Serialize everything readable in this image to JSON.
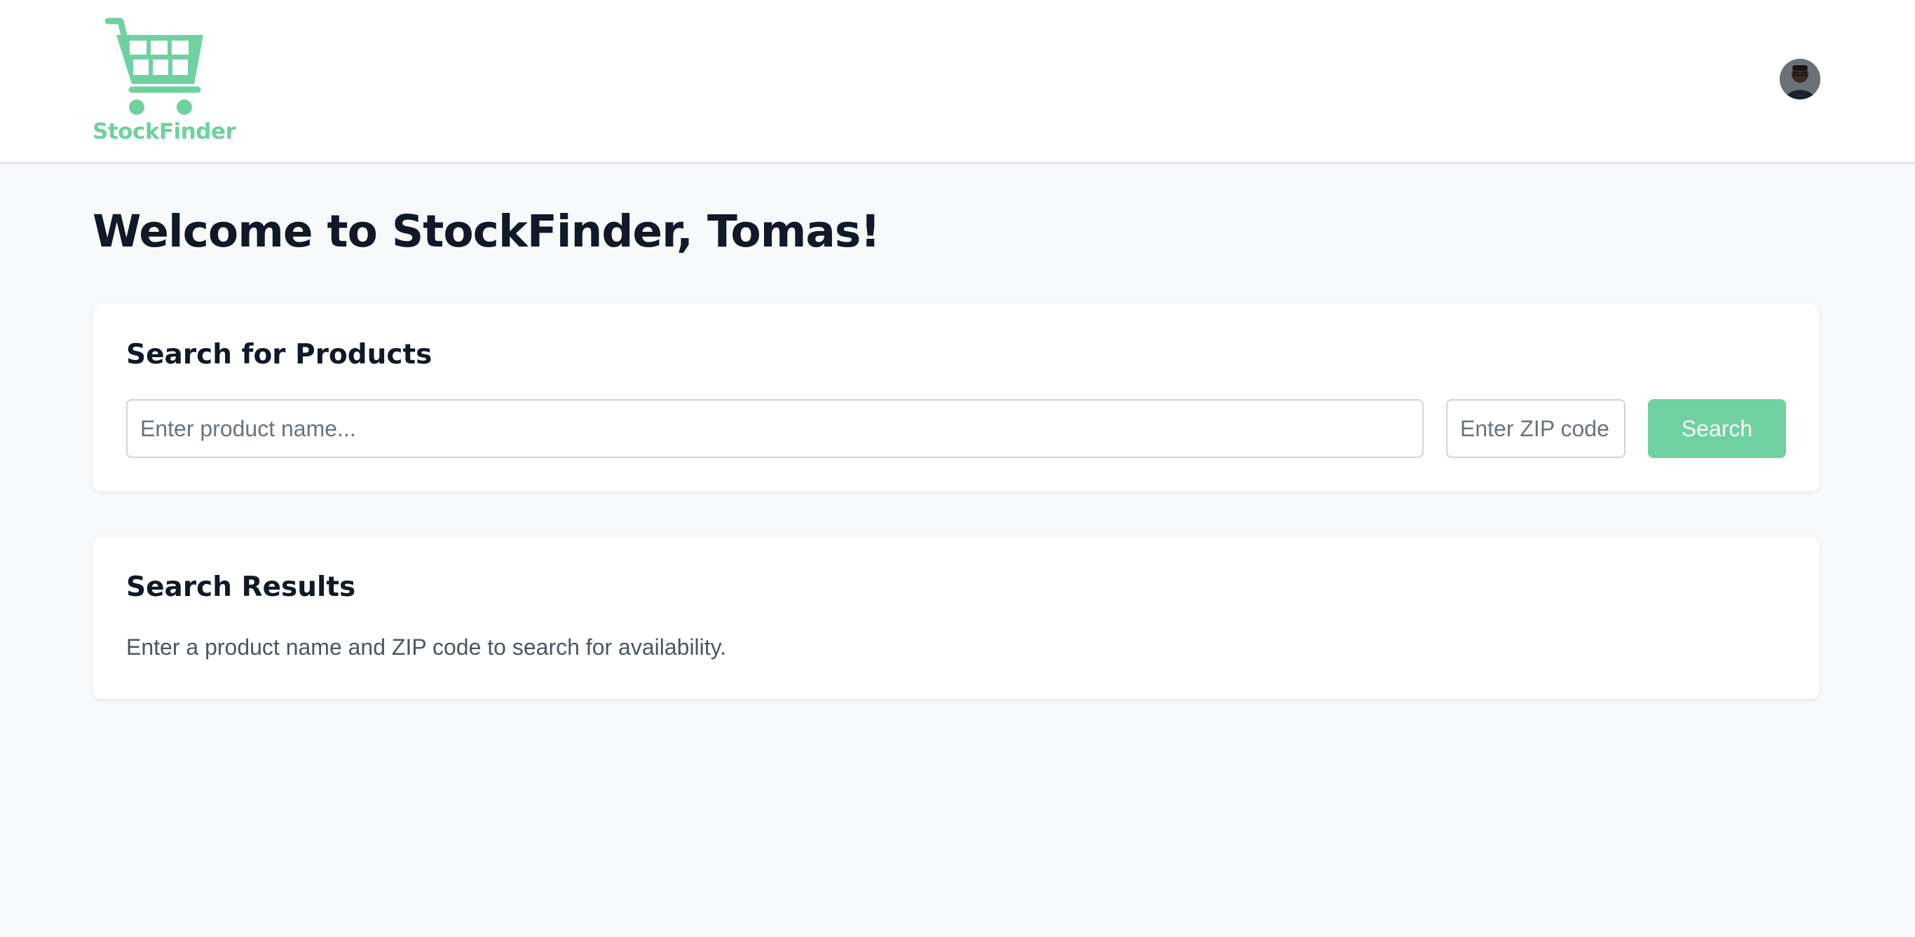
{
  "brand": {
    "name": "StockFinder",
    "accent_color": "#6fd19f",
    "logo_icon": "shopping-cart-icon"
  },
  "header": {
    "avatar": "user-avatar"
  },
  "welcome": {
    "title": "Welcome to StockFinder, Tomas!"
  },
  "search_card": {
    "title": "Search for Products",
    "product_placeholder": "Enter product name...",
    "product_value": "",
    "zip_placeholder": "Enter ZIP code",
    "zip_value": "",
    "button_label": "Search"
  },
  "results_card": {
    "title": "Search Results",
    "message": "Enter a product name and ZIP code to search for availability."
  }
}
